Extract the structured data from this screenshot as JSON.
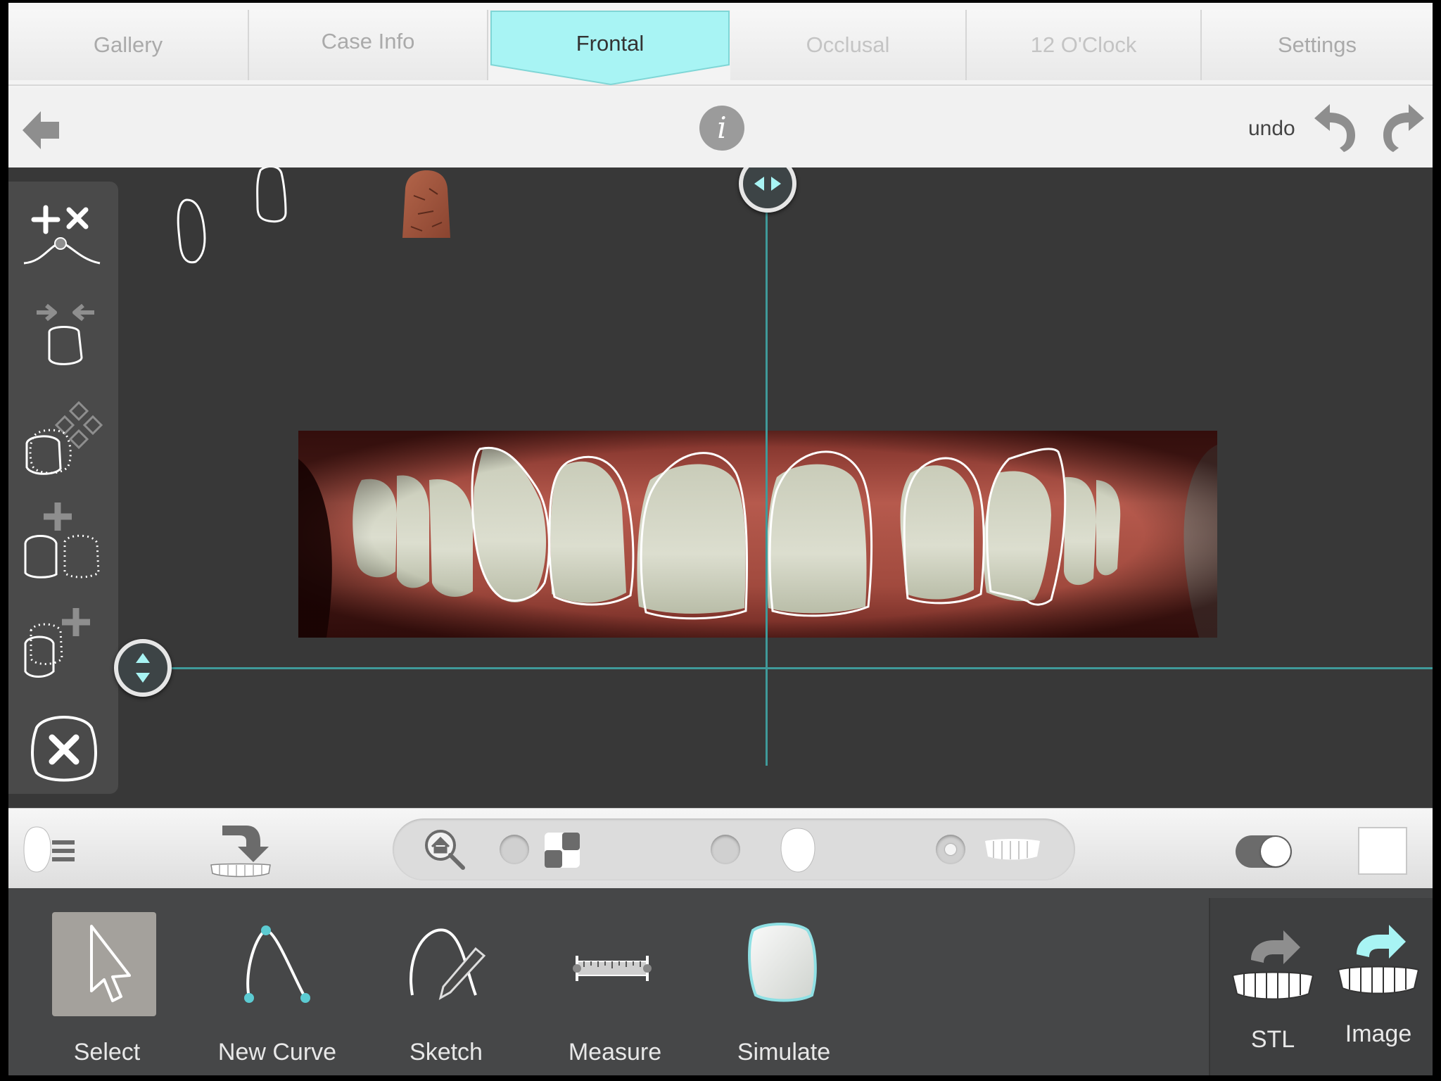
{
  "tabs": [
    {
      "label": "Gallery",
      "state": "normal"
    },
    {
      "label": "Case Info",
      "state": "normal"
    },
    {
      "label": "Frontal",
      "state": "active"
    },
    {
      "label": "Occlusal",
      "state": "disabled"
    },
    {
      "label": "12 O'Clock",
      "state": "disabled"
    },
    {
      "label": "Settings",
      "state": "normal"
    }
  ],
  "toolbar": {
    "undo_label": "undo",
    "info_glyph": "i"
  },
  "icons": {
    "back": "arrow-left-icon",
    "info": "info-icon",
    "undo": "undo-arrow-icon",
    "redo": "redo-arrow-icon"
  },
  "side_tools": [
    {
      "name": "add-remove-points-tool",
      "icon": "add-remove-point-icon"
    },
    {
      "name": "shrink-shape-tool",
      "icon": "shrink-shape-icon"
    },
    {
      "name": "move-shape-tool",
      "icon": "move-shape-icon"
    },
    {
      "name": "duplicate-shape-tool",
      "icon": "duplicate-shape-icon"
    },
    {
      "name": "add-shape-tool",
      "icon": "add-shape-icon"
    },
    {
      "name": "delete-shape-tool",
      "icon": "delete-shape-icon"
    }
  ],
  "options": {
    "icons": [
      "face-menu-icon",
      "import-teeth-icon",
      "home-zoom-icon",
      "checker-icon",
      "face-icon",
      "teeth-icon",
      "toggle-switch",
      "color-swatch"
    ],
    "radios": {
      "checker": false,
      "face": false,
      "teeth": true
    },
    "toggle_on": true,
    "swatch_color": "#ffffff"
  },
  "tools": {
    "select": "Select",
    "new_curve": "New Curve",
    "sketch": "Sketch",
    "measure": "Measure",
    "simulate": "Simulate",
    "selected": "select"
  },
  "export": {
    "stl": "STL",
    "image": "Image"
  },
  "colors": {
    "accent": "#a8f4f4",
    "guide_line": "#3f9a9a",
    "canvas_bg": "#383838",
    "tool_panel": "#464748"
  }
}
